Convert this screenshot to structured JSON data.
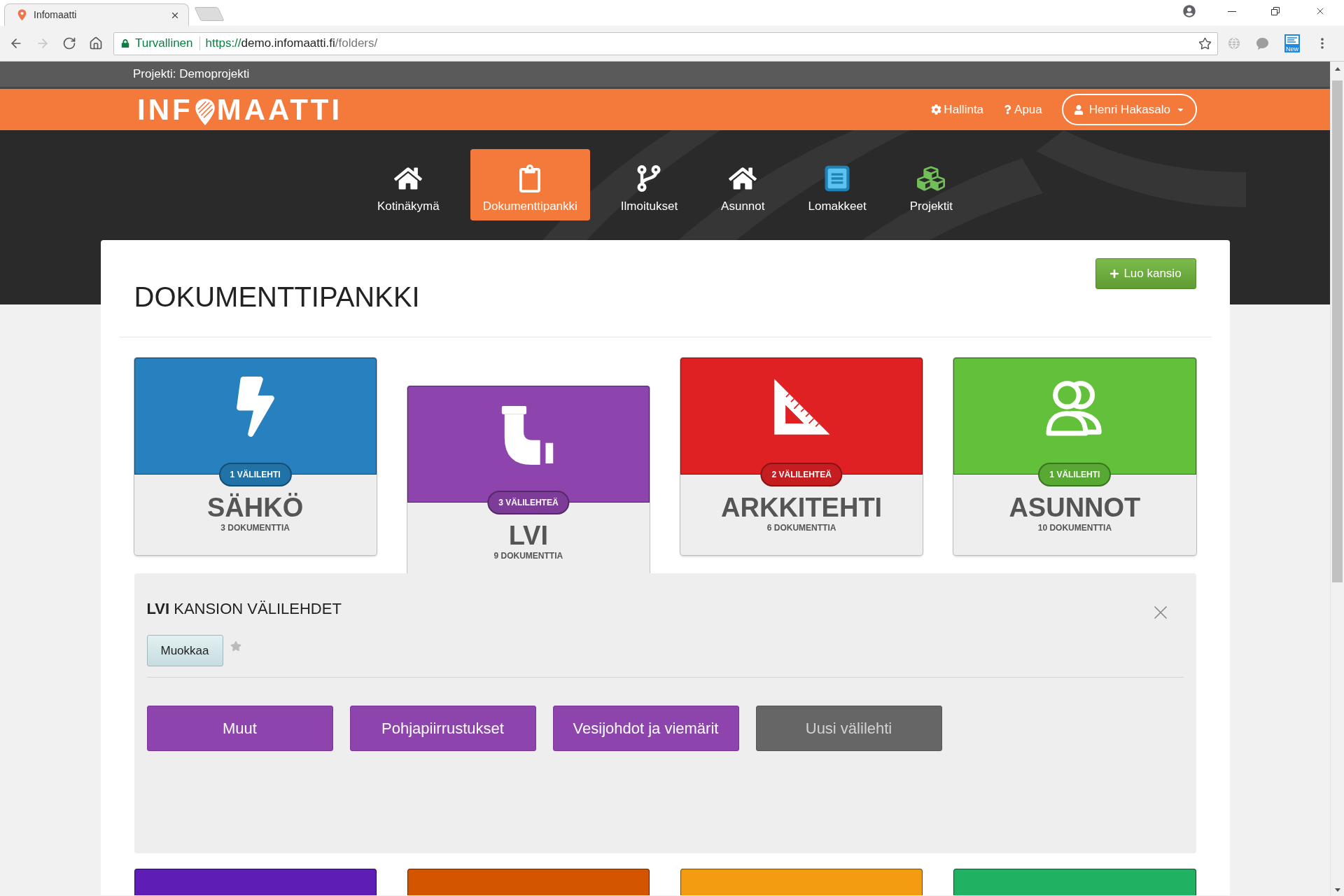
{
  "browser": {
    "tab": {
      "title": "Infomaatti"
    },
    "nav_buttons": [
      {
        "kind": "back",
        "disabled": false
      },
      {
        "kind": "forward",
        "disabled": true
      },
      {
        "kind": "reload",
        "disabled": false
      },
      {
        "kind": "home",
        "disabled": false
      }
    ],
    "security_label": "Turvallinen",
    "url": {
      "scheme": "https://",
      "host": "demo.infomaatti.fi",
      "path": "/folders/"
    },
    "extension_badge": "New"
  },
  "project_bar": {
    "label": "Projekti: Demoprojekti"
  },
  "header": {
    "logo": {
      "left": "INF",
      "right": "MAATTI"
    },
    "links": [
      {
        "kind": "settings",
        "label": "Hallinta"
      },
      {
        "kind": "help",
        "label": "Apua"
      }
    ],
    "user": {
      "name": "Henri Hakasalo"
    }
  },
  "nav": [
    {
      "kind": "home",
      "label": "Kotinäkymä",
      "selected": false
    },
    {
      "kind": "documents",
      "label": "Dokumenttipankki",
      "selected": true
    },
    {
      "kind": "notifications",
      "label": "Ilmoitukset",
      "selected": false
    },
    {
      "kind": "apartments",
      "label": "Asunnot",
      "selected": false
    },
    {
      "kind": "forms",
      "label": "Lomakkeet",
      "selected": false
    },
    {
      "kind": "projects",
      "label": "Projektit",
      "selected": false
    }
  ],
  "page": {
    "title": "DOKUMENTTIPANKKI",
    "create_button": "Luo kansio"
  },
  "folders": [
    {
      "kind": "electrical",
      "name": "SÄHKÖ",
      "badge": "1 VÄLILEHTI",
      "documents": "3 DOKUMENTTIA",
      "color": "#2681be",
      "selected": false
    },
    {
      "kind": "plumbing",
      "name": "LVI",
      "badge": "3 VÄLILEHTEÄ",
      "documents": "9 DOKUMENTTIA",
      "color": "#8e44ad",
      "selected": true
    },
    {
      "kind": "architecture",
      "name": "ARKKITEHTI",
      "badge": "2 VÄLILEHTEÄ",
      "documents": "6 DOKUMENTTIA",
      "color": "#e02124",
      "selected": false
    },
    {
      "kind": "apartments",
      "name": "ASUNNOT",
      "badge": "1 VÄLILEHTI",
      "documents": "10 DOKUMENTTIA",
      "color": "#63c03b",
      "selected": false
    }
  ],
  "folder_panel": {
    "title": "**LVI** KANSION VÄLILEHDET",
    "edit_button": "Muokkaa",
    "favorite": false,
    "tabs": [
      {
        "kind": "tab",
        "label": "Muut"
      },
      {
        "kind": "tab",
        "label": "Pohjapiirrustukset"
      },
      {
        "kind": "tab",
        "label": "Vesijohdot ja viemärit"
      },
      {
        "kind": "new",
        "label": "Uusi välilehti"
      }
    ]
  },
  "more_folders": [
    {
      "color": "#5e1db5"
    },
    {
      "color": "#d45500"
    },
    {
      "color": "#f39c12"
    },
    {
      "color": "#20b262"
    }
  ]
}
